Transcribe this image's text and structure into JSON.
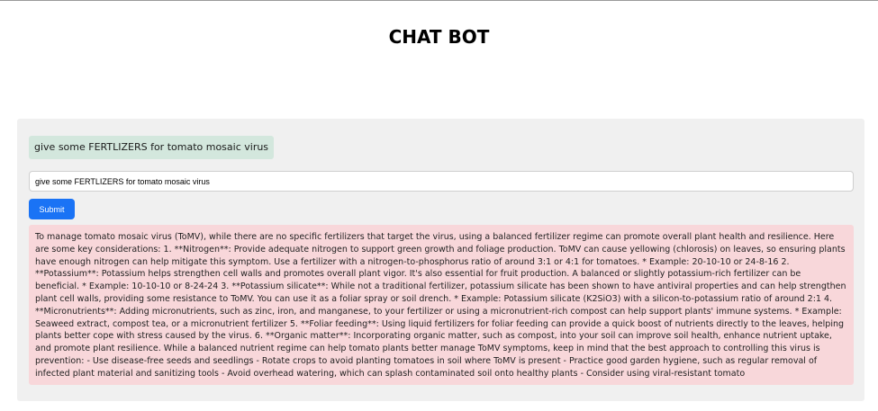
{
  "header": {
    "title": "CHAT BOT"
  },
  "chat": {
    "user_message": "give some FERTLIZERS for tomato mosaic virus",
    "input_value": "give some FERTLIZERS for tomato mosaic virus",
    "submit_label": "Submit",
    "bot_response": "To manage tomato mosaic virus (ToMV), while there are no specific fertilizers that target the virus, using a balanced fertilizer regime can promote overall plant health and resilience. Here are some key considerations: 1. **Nitrogen**: Provide adequate nitrogen to support green growth and foliage production. ToMV can cause yellowing (chlorosis) on leaves, so ensuring plants have enough nitrogen can help mitigate this symptom. Use a fertilizer with a nitrogen-to-phosphorus ratio of around 3:1 or 4:1 for tomatoes. * Example: 20-10-10 or 24-8-16 2. **Potassium**: Potassium helps strengthen cell walls and promotes overall plant vigor. It's also essential for fruit production. A balanced or slightly potassium-rich fertilizer can be beneficial. * Example: 10-10-10 or 8-24-24 3. **Potassium silicate**: While not a traditional fertilizer, potassium silicate has been shown to have antiviral properties and can help strengthen plant cell walls, providing some resistance to ToMV. You can use it as a foliar spray or soil drench. * Example: Potassium silicate (K2SiO3) with a silicon-to-potassium ratio of around 2:1 4. **Micronutrients**: Adding micronutrients, such as zinc, iron, and manganese, to your fertilizer or using a micronutrient-rich compost can help support plants' immune systems. * Example: Seaweed extract, compost tea, or a micronutrient fertilizer 5. **Foliar feeding**: Using liquid fertilizers for foliar feeding can provide a quick boost of nutrients directly to the leaves, helping plants better cope with stress caused by the virus. 6. **Organic matter**: Incorporating organic matter, such as compost, into your soil can improve soil health, enhance nutrient uptake, and promote plant resilience. While a balanced nutrient regime can help tomato plants better manage ToMV symptoms, keep in mind that the best approach to controlling this virus is prevention: - Use disease-free seeds and seedlings - Rotate crops to avoid planting tomatoes in soil where ToMV is present - Practice good garden hygiene, such as regular removal of infected plant material and sanitizing tools - Avoid overhead watering, which can splash contaminated soil onto healthy plants - Consider using viral-resistant tomato"
  },
  "colors": {
    "user_bubble": "#d3e7dd",
    "bot_bubble": "#f8d7da",
    "panel": "#f0f0f0",
    "accent": "#1a73f5"
  }
}
